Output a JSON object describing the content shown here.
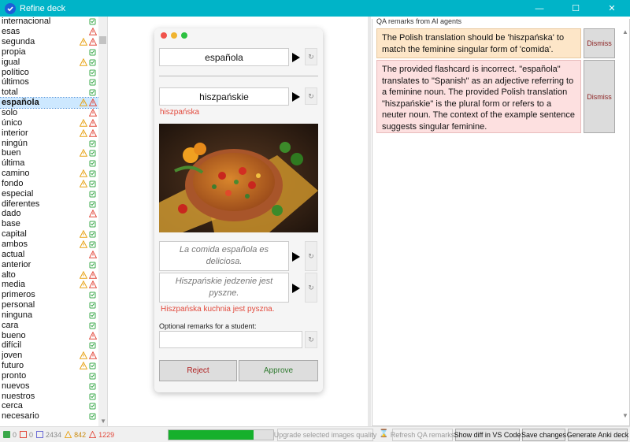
{
  "window": {
    "title": "Refine deck",
    "minimize": "—",
    "maximize": "☐",
    "close": "✕"
  },
  "words": [
    {
      "w": "internacional",
      "i": [
        "ok"
      ]
    },
    {
      "w": "esas",
      "i": [
        "err"
      ]
    },
    {
      "w": "segunda",
      "i": [
        "warn",
        "err"
      ]
    },
    {
      "w": "propia",
      "i": [
        "ok"
      ]
    },
    {
      "w": "igual",
      "i": [
        "warn",
        "ok"
      ]
    },
    {
      "w": "político",
      "i": [
        "ok"
      ]
    },
    {
      "w": "últimos",
      "i": [
        "ok"
      ]
    },
    {
      "w": "total",
      "i": [
        "ok"
      ]
    },
    {
      "w": "española",
      "i": [
        "warn",
        "err"
      ],
      "selected": true
    },
    {
      "w": "solo",
      "i": [
        "err"
      ]
    },
    {
      "w": "único",
      "i": [
        "warn",
        "err"
      ]
    },
    {
      "w": "interior",
      "i": [
        "warn",
        "err"
      ]
    },
    {
      "w": "ningún",
      "i": [
        "ok"
      ]
    },
    {
      "w": "buen",
      "i": [
        "warn",
        "ok"
      ]
    },
    {
      "w": "última",
      "i": [
        "ok"
      ]
    },
    {
      "w": "camino",
      "i": [
        "warn",
        "ok"
      ]
    },
    {
      "w": "fondo",
      "i": [
        "warn",
        "ok"
      ]
    },
    {
      "w": "especial",
      "i": [
        "ok"
      ]
    },
    {
      "w": "diferentes",
      "i": [
        "ok"
      ]
    },
    {
      "w": "dado",
      "i": [
        "err"
      ]
    },
    {
      "w": "base",
      "i": [
        "ok"
      ]
    },
    {
      "w": "capital",
      "i": [
        "warn",
        "ok"
      ]
    },
    {
      "w": "ambos",
      "i": [
        "warn",
        "ok"
      ]
    },
    {
      "w": "actual",
      "i": [
        "err"
      ]
    },
    {
      "w": "anterior",
      "i": [
        "ok"
      ]
    },
    {
      "w": "alto",
      "i": [
        "warn",
        "err"
      ]
    },
    {
      "w": "media",
      "i": [
        "warn",
        "err"
      ]
    },
    {
      "w": "primeros",
      "i": [
        "ok"
      ]
    },
    {
      "w": "personal",
      "i": [
        "ok"
      ]
    },
    {
      "w": "ninguna",
      "i": [
        "ok"
      ]
    },
    {
      "w": "cara",
      "i": [
        "ok"
      ]
    },
    {
      "w": "bueno",
      "i": [
        "err"
      ]
    },
    {
      "w": "difícil",
      "i": [
        "ok"
      ]
    },
    {
      "w": "joven",
      "i": [
        "warn",
        "err"
      ]
    },
    {
      "w": "futuro",
      "i": [
        "warn",
        "ok"
      ]
    },
    {
      "w": "pronto",
      "i": [
        "ok"
      ]
    },
    {
      "w": "nuevos",
      "i": [
        "ok"
      ]
    },
    {
      "w": "nuestros",
      "i": [
        "ok"
      ]
    },
    {
      "w": "cerca",
      "i": [
        "ok"
      ]
    },
    {
      "w": "necesario",
      "i": [
        "ok"
      ]
    }
  ],
  "card": {
    "front": "española",
    "back": "hiszpańskie",
    "back_suggestion": "hiszpańska",
    "sentence_front": "La comida española es deliciosa.",
    "sentence_back": "Hiszpańskie jedzenie jest pyszne.",
    "sentence_suggestion": "Hiszpańska kuchnia jest pyszna.",
    "remarks_label": "Optional remarks for a student:",
    "remarks_value": "",
    "reject_label": "Reject",
    "approve_label": "Approve"
  },
  "qa": {
    "title": "QA remarks from AI agents",
    "remarks": [
      {
        "text": "The Polish translation should be 'hiszpańska' to match the feminine singular form of 'comida'.",
        "dismiss": "Dismiss"
      },
      {
        "text": "The provided flashcard is incorrect.  \"española\" translates to \"Spanish\" as an adjective referring to a feminine noun. The provided Polish translation \"hiszpańskie\" is the plural form or refers to a neuter noun.  The context of the example sentence suggests singular feminine.",
        "dismiss": "Dismiss"
      }
    ]
  },
  "status": {
    "ok_count": "0",
    "err_count": "0",
    "total_count": "2434",
    "warn_count": "842",
    "pending_count": "1229",
    "progress": 0.81,
    "btn_upgrade": "Upgrade selected images quality",
    "btn_refresh": "Refresh QA remarks",
    "btn_diff": "Show diff in VS Code",
    "btn_save": "Save changes",
    "btn_generate": "Generate Anki deck"
  },
  "colors": {
    "accent": "#00b4c8",
    "ok": "#3aa84a",
    "warn": "#e8a317",
    "err": "#e24a3d",
    "progress": "#16b02c"
  }
}
